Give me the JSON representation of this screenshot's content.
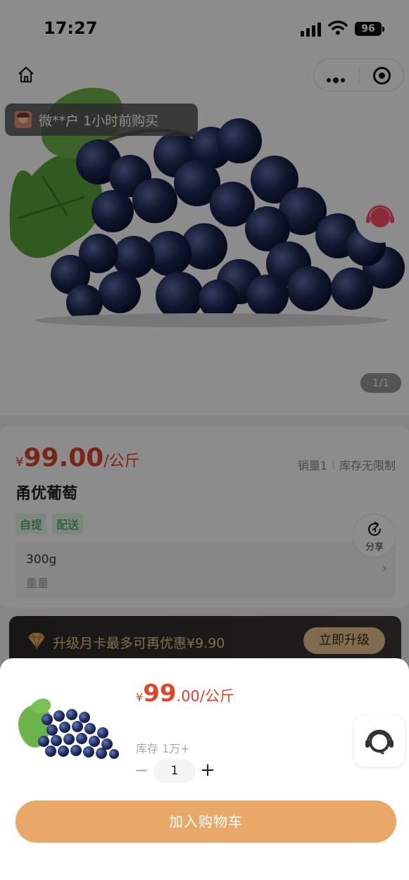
{
  "status_bar": {
    "time": "17:27",
    "battery": "96"
  },
  "purchase_toast": {
    "text": "微**户 1小时前购买"
  },
  "gallery": {
    "indicator": "1/1"
  },
  "product": {
    "price_symbol": "¥",
    "price": "99.00",
    "unit": "/公斤",
    "sales": "销量1",
    "stock": "库存无限制",
    "name": "甬优葡萄",
    "tags": [
      "自提",
      "配送"
    ],
    "spec_value": "300g",
    "spec_label": "重量"
  },
  "share": {
    "label": "分享"
  },
  "vip": {
    "text": "升级月卡最多可再优惠¥9.90",
    "button": "立即升级"
  },
  "sheet": {
    "price_symbol": "¥",
    "price_int": "99",
    "price_dec": ".00",
    "unit": "/公斤",
    "stock": "库存 1万+",
    "quantity": "1",
    "minus": "−",
    "plus": "+",
    "add_to_cart": "加入购物车"
  },
  "colors": {
    "price": "#e0442b",
    "tag": "#1e9a4b",
    "cart_button": "#e9a868",
    "vip_gold": "#e9c48e"
  },
  "icons": [
    "home-icon",
    "more-icon",
    "target-icon",
    "headset-icon",
    "share-icon",
    "diamond-icon",
    "chevron-right-icon"
  ]
}
